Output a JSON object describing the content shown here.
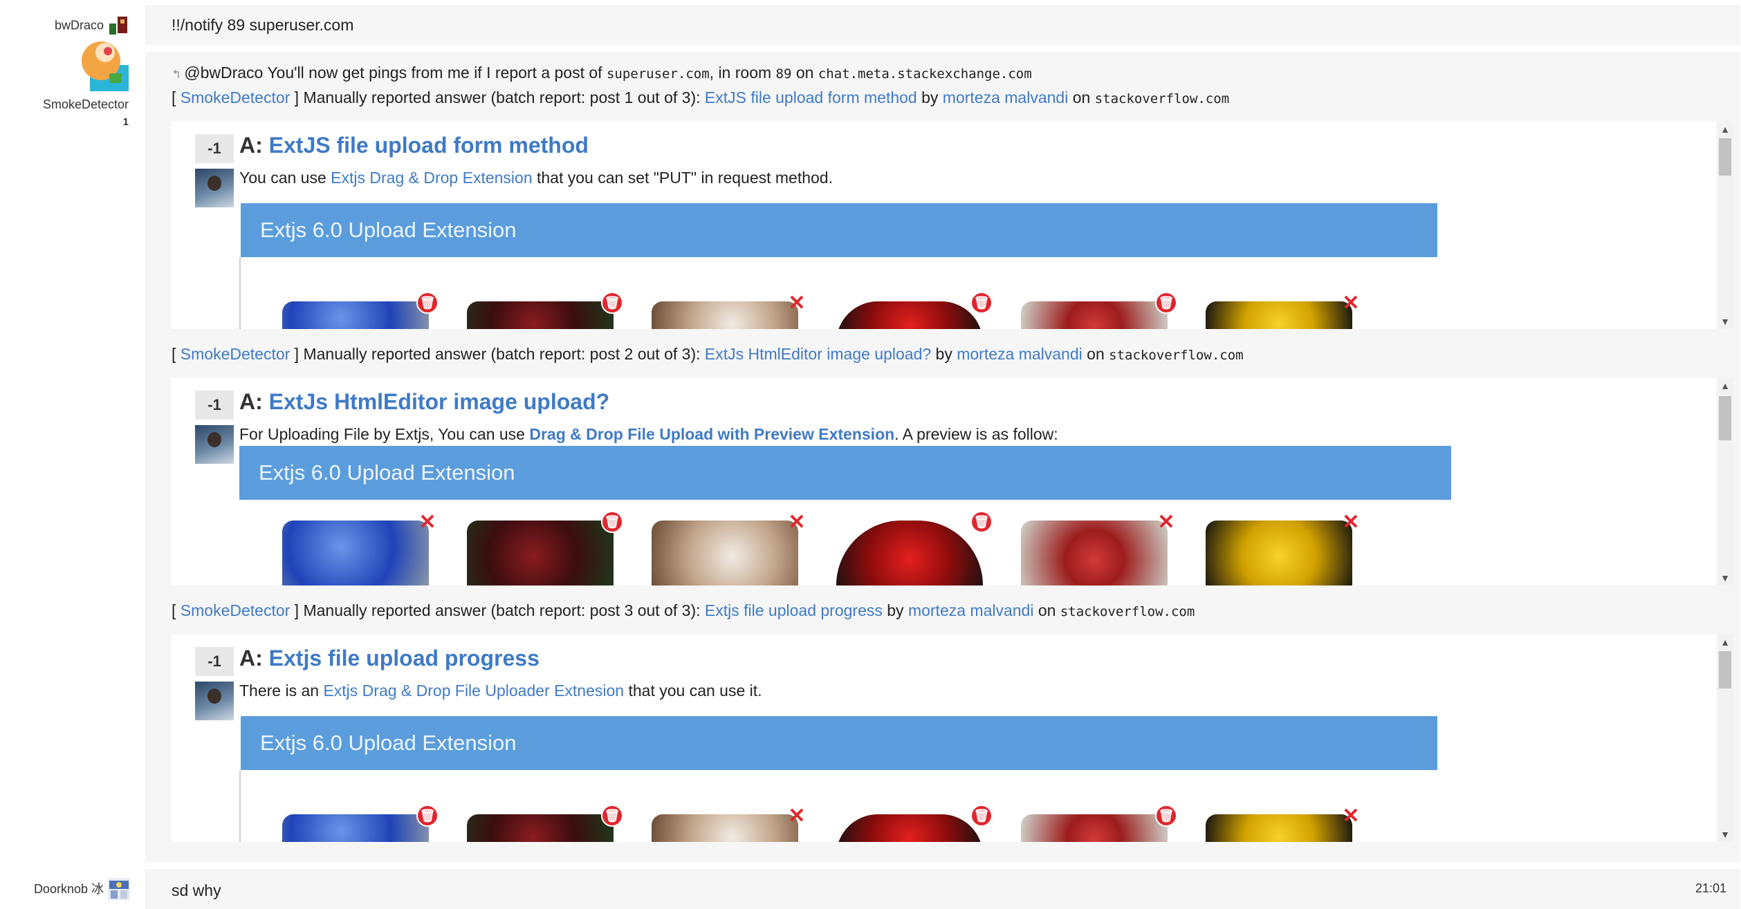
{
  "chat": {
    "users": {
      "bwdraco": "bwDraco",
      "smokedetector": "SmokeDetector",
      "smokedetector_badge": "1",
      "doorknob": "Doorknob 冰"
    },
    "msg1": {
      "text": "!!/notify 89 superuser.com"
    },
    "msg2": {
      "reply_prefix": "@bwDraco You'll now get pings from me if I report a post of ",
      "reply_site": "superuser.com",
      "reply_mid": ", in room ",
      "reply_room": "89",
      "reply_on": " on ",
      "reply_server": "chat.meta.stackexchange.com"
    },
    "reports": [
      {
        "open": "[ ",
        "bot": "SmokeDetector",
        "close_text": " ] Manually reported answer (batch report: post 1 out of 3): ",
        "post_link": "ExtJS file upload form method",
        "by": " by ",
        "author": "morteza malvandi",
        "on": " on ",
        "site": "stackoverflow.com",
        "onebox": {
          "score": "-1",
          "prefix": "A: ",
          "title": "ExtJS file upload form method",
          "body_pre": "You can use ",
          "body_link": "Extjs Drag & Drop Extension",
          "body_post": " that you can set \"PUT\" in request method.",
          "banner": "Extjs 6.0 Upload Extension"
        }
      },
      {
        "open": "[ ",
        "bot": "SmokeDetector",
        "close_text": " ] Manually reported answer (batch report: post 2 out of 3): ",
        "post_link": "ExtJs HtmlEditor image upload?",
        "by": " by ",
        "author": "morteza malvandi",
        "on": " on ",
        "site": "stackoverflow.com",
        "onebox": {
          "score": "-1",
          "prefix": "A: ",
          "title": "ExtJs HtmlEditor image upload?",
          "body_pre": "For Uploading File by Extjs, You can use ",
          "body_link": "Drag & Drop File Upload with Preview Extension",
          "body_post": ". A preview is as follow:",
          "banner": "Extjs 6.0 Upload Extension"
        }
      },
      {
        "open": "[ ",
        "bot": "SmokeDetector",
        "close_text": " ] Manually reported answer (batch report: post 3 out of 3): ",
        "post_link": "Extjs file upload progress",
        "by": " by ",
        "author": "morteza malvandi",
        "on": " on ",
        "site": "stackoverflow.com",
        "onebox": {
          "score": "-1",
          "prefix": "A: ",
          "title": "Extjs file upload progress",
          "body_pre": "There is an ",
          "body_link": "Extjs Drag & Drop File Uploader Extnesion",
          "body_post": " that you can use it.",
          "banner": "Extjs 6.0 Upload Extension"
        }
      }
    ],
    "msg_last": {
      "text": "sd why",
      "time": "21:01"
    }
  },
  "icons": {
    "reply": "reply-arrow-icon",
    "delete": "trash-icon",
    "remove": "red-x-icon",
    "scroll_up": "chevron-up-icon",
    "scroll_down": "chevron-down-icon"
  },
  "colors": {
    "link": "#3f7ac6",
    "banner": "#5b9ddc",
    "bubble": "#f6f6f6",
    "badge_red": "#e0262d"
  }
}
